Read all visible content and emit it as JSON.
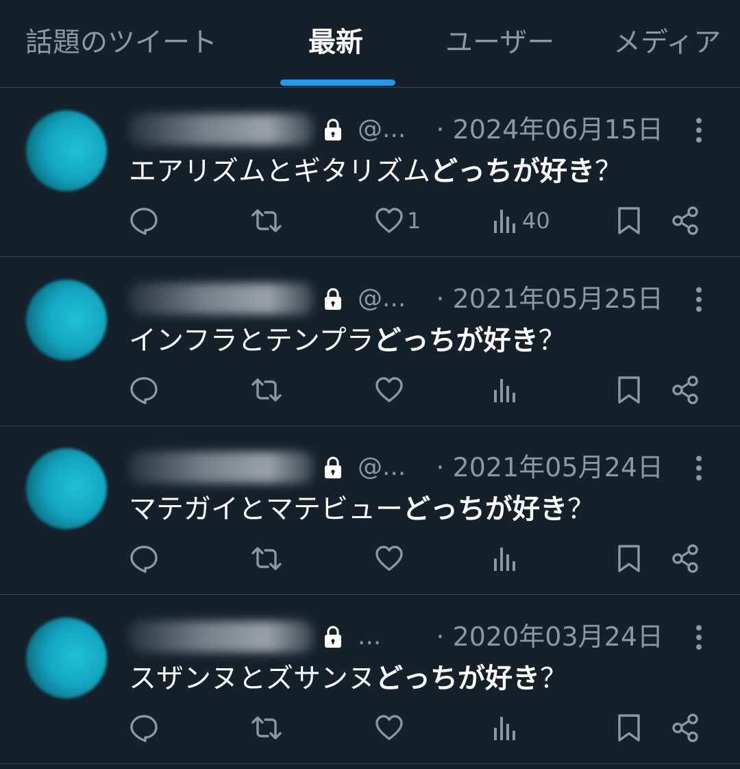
{
  "tabs": [
    {
      "label": "話題のツイート"
    },
    {
      "label": "最新"
    },
    {
      "label": "ユーザー"
    },
    {
      "label": "メディア"
    }
  ],
  "tweets": [
    {
      "handle": "@...",
      "date": "· 2024年06月15日",
      "text_plain": "エアリズムとギタリズム",
      "text_bold": "どっちが好き",
      "text_tail": "？",
      "likes": "1",
      "views": "40"
    },
    {
      "handle": "@...",
      "date": "· 2021年05月25日",
      "text_plain": "インフラとテンプラ",
      "text_bold": "どっちが好き",
      "text_tail": "？",
      "likes": "",
      "views": ""
    },
    {
      "handle": "@...",
      "date": "· 2021年05月24日",
      "text_plain": "マテガイとマテビュー",
      "text_bold": "どっちが好き",
      "text_tail": "？",
      "likes": "",
      "views": ""
    },
    {
      "handle": "...",
      "date": "· 2020年03月24日",
      "text_plain": "スザンヌとズサンヌ",
      "text_bold": "どっちが好き",
      "text_tail": "？",
      "likes": "",
      "views": ""
    }
  ],
  "icons": {
    "reply": "reply-icon",
    "retweet": "retweet-icon",
    "like": "heart-icon",
    "views": "bar-chart-icon",
    "bookmark": "bookmark-icon",
    "share": "share-icon",
    "more": "more-vertical-icon",
    "lock": "lock-icon"
  },
  "colors": {
    "background": "#15202b",
    "accent": "#1d9bf0",
    "muted": "#8b98a5",
    "divider": "#38444d"
  }
}
